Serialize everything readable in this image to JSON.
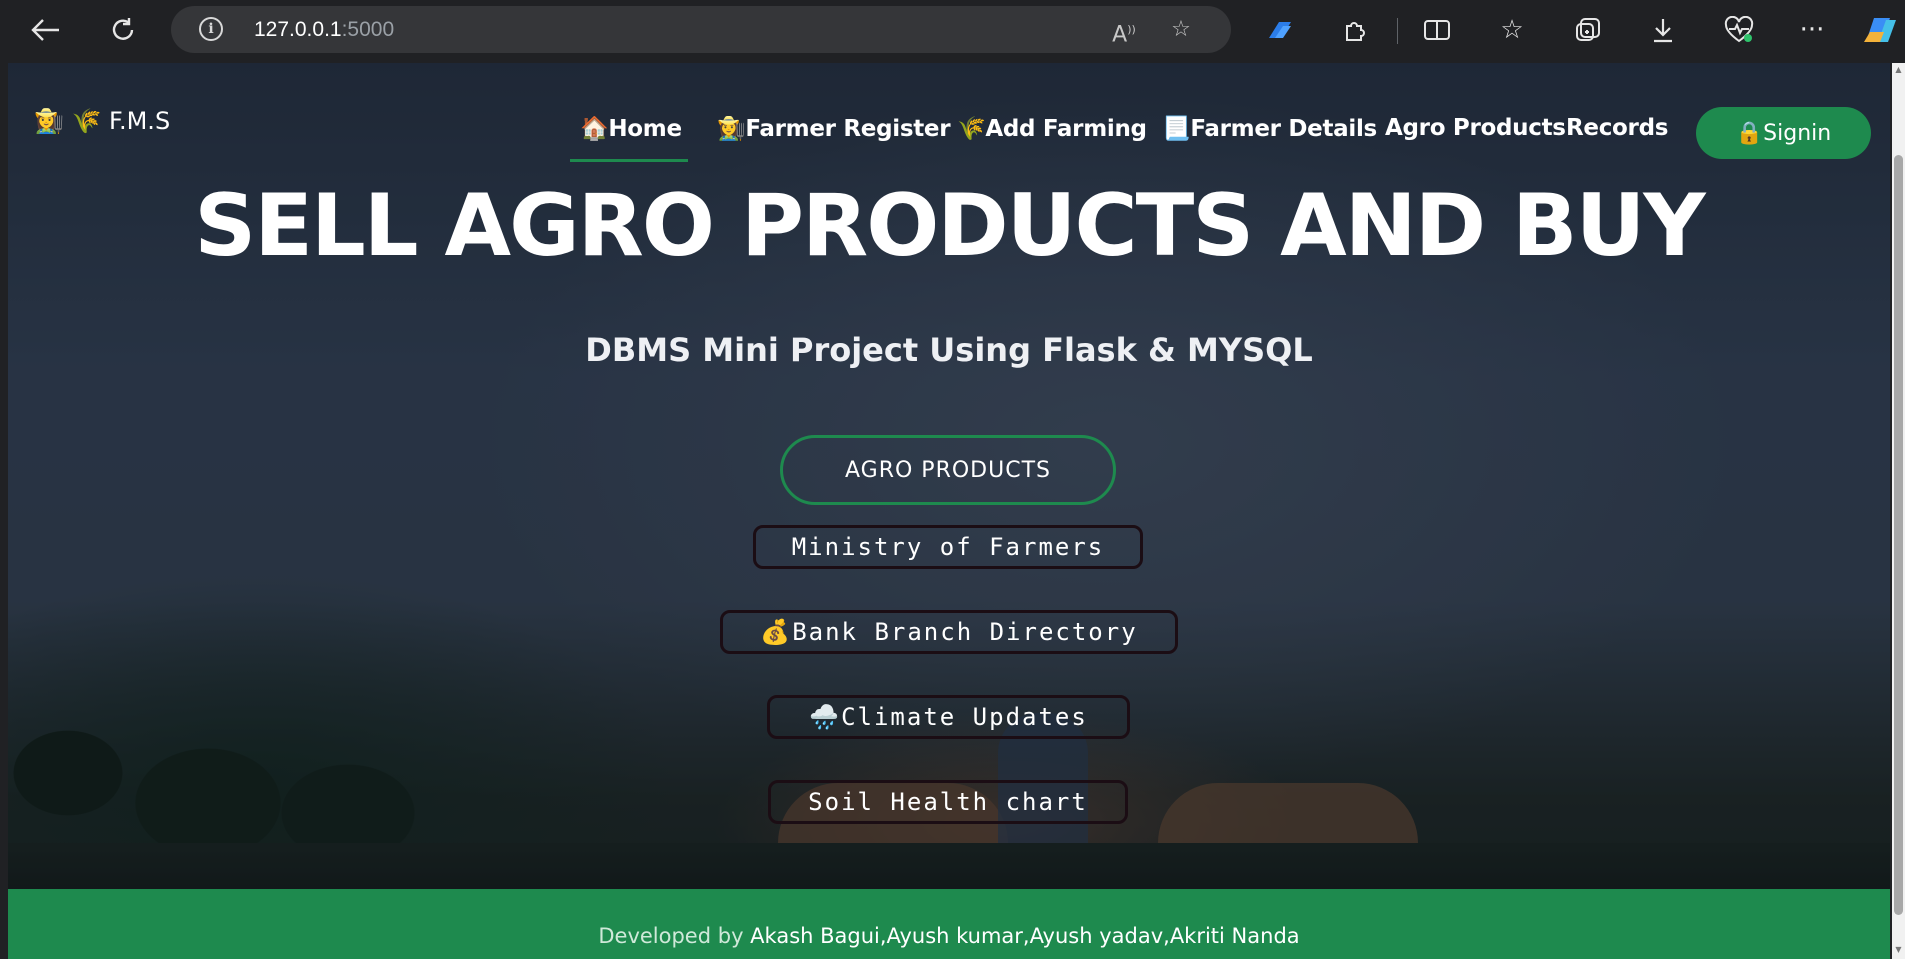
{
  "browser": {
    "url_host": "127.0.0.1",
    "url_port": ":5000",
    "icons": {
      "back": "back-arrow-icon",
      "refresh": "refresh-icon",
      "info": "info-icon",
      "read_aloud": "read-aloud-icon",
      "favorite": "star-icon",
      "extensions": "puzzle-icon",
      "split": "split-screen-icon",
      "favorites": "favorites-icon",
      "collections": "collections-icon",
      "downloads": "download-icon",
      "health": "heartbeat-icon",
      "more": "more-icon",
      "copilot": "copilot-icon"
    }
  },
  "site": {
    "brand": "👩‍🌾 🌾 F.M.S",
    "nav": [
      {
        "label": "🏠Home",
        "active": true
      },
      {
        "label": "👩‍🌾Farmer Register"
      },
      {
        "label": "🌾Add Farming"
      },
      {
        "label": "📃Farmer Details"
      },
      {
        "label": "Agro Products"
      },
      {
        "label": "Records"
      }
    ],
    "signin": "🔒Signin"
  },
  "hero": {
    "title": "SELL AGRO PRODUCTS AND BUY",
    "subtitle": "DBMS Mini Project Using Flask & MYSQL",
    "primary_button": "AGRO PRODUCTS",
    "links": [
      "Ministry of Farmers",
      "💰Bank Branch Directory",
      "🌧️Climate Updates",
      "Soil Health chart"
    ]
  },
  "footer": {
    "label": "Developed by ",
    "names": "Akash Bagui,Ayush kumar,Ayush yadav,Akriti Nanda"
  },
  "colors": {
    "accent": "#1e8a4e",
    "chrome": "#202124",
    "omnibox": "#353639"
  }
}
